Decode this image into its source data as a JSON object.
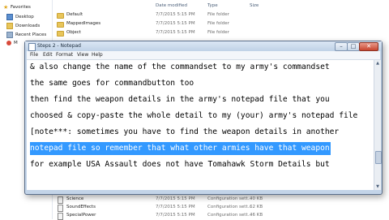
{
  "explorer": {
    "nav_items": [
      {
        "label": "Favorites",
        "icon": "star-icon"
      },
      {
        "label": "Desktop",
        "icon": "desktop-icon"
      },
      {
        "label": "Downloads",
        "icon": "downloads-icon"
      },
      {
        "label": "Recent Places",
        "icon": "recent-places-icon"
      },
      {
        "label": "M",
        "icon": "folder-icon"
      }
    ],
    "columns": {
      "date": "Date modified",
      "type": "Type",
      "size": "Size"
    },
    "rows_top": [
      {
        "name": "Default",
        "date": "7/7/2015 5:15 PM",
        "type": "File folder",
        "size": ""
      },
      {
        "name": "MappedImages",
        "date": "7/7/2015 5:15 PM",
        "type": "File folder",
        "size": ""
      },
      {
        "name": "Object",
        "date": "7/7/2015 5:15 PM",
        "type": "File folder",
        "size": ""
      }
    ],
    "rows_bottom": [
      {
        "name": "Science",
        "date": "7/7/2015 5:15 PM",
        "type": "Configuration sett...",
        "size": "40 KB"
      },
      {
        "name": "SoundEffects",
        "date": "7/7/2015 5:15 PM",
        "type": "Configuration sett...",
        "size": "62 KB"
      },
      {
        "name": "SpecialPower",
        "date": "7/7/2015 5:15 PM",
        "type": "Configuration sett...",
        "size": "46 KB"
      }
    ]
  },
  "notepad": {
    "title": "Steps 2 - Notepad",
    "menu": [
      "File",
      "Edit",
      "Format",
      "View",
      "Help"
    ],
    "lines": [
      "& also change the name of the commandset to my army's commandset",
      "the same goes for commandbutton too",
      "then find the weapon details in the army's notepad file that you",
      "choosed & copy-paste the whole detail to my (your) army's notepad file",
      "[note***: sometimes you have to find the weapon details in another",
      "notepad file so remember that what other armies have that weapon",
      "for example USA Assault does not have Tomahawk Storm Details but"
    ],
    "selected_line": 5,
    "vscroll_position": 0.7
  },
  "colors": {
    "selection": "#3399ff",
    "titlebar": "#c3d4e8",
    "close": "#c8452f"
  }
}
